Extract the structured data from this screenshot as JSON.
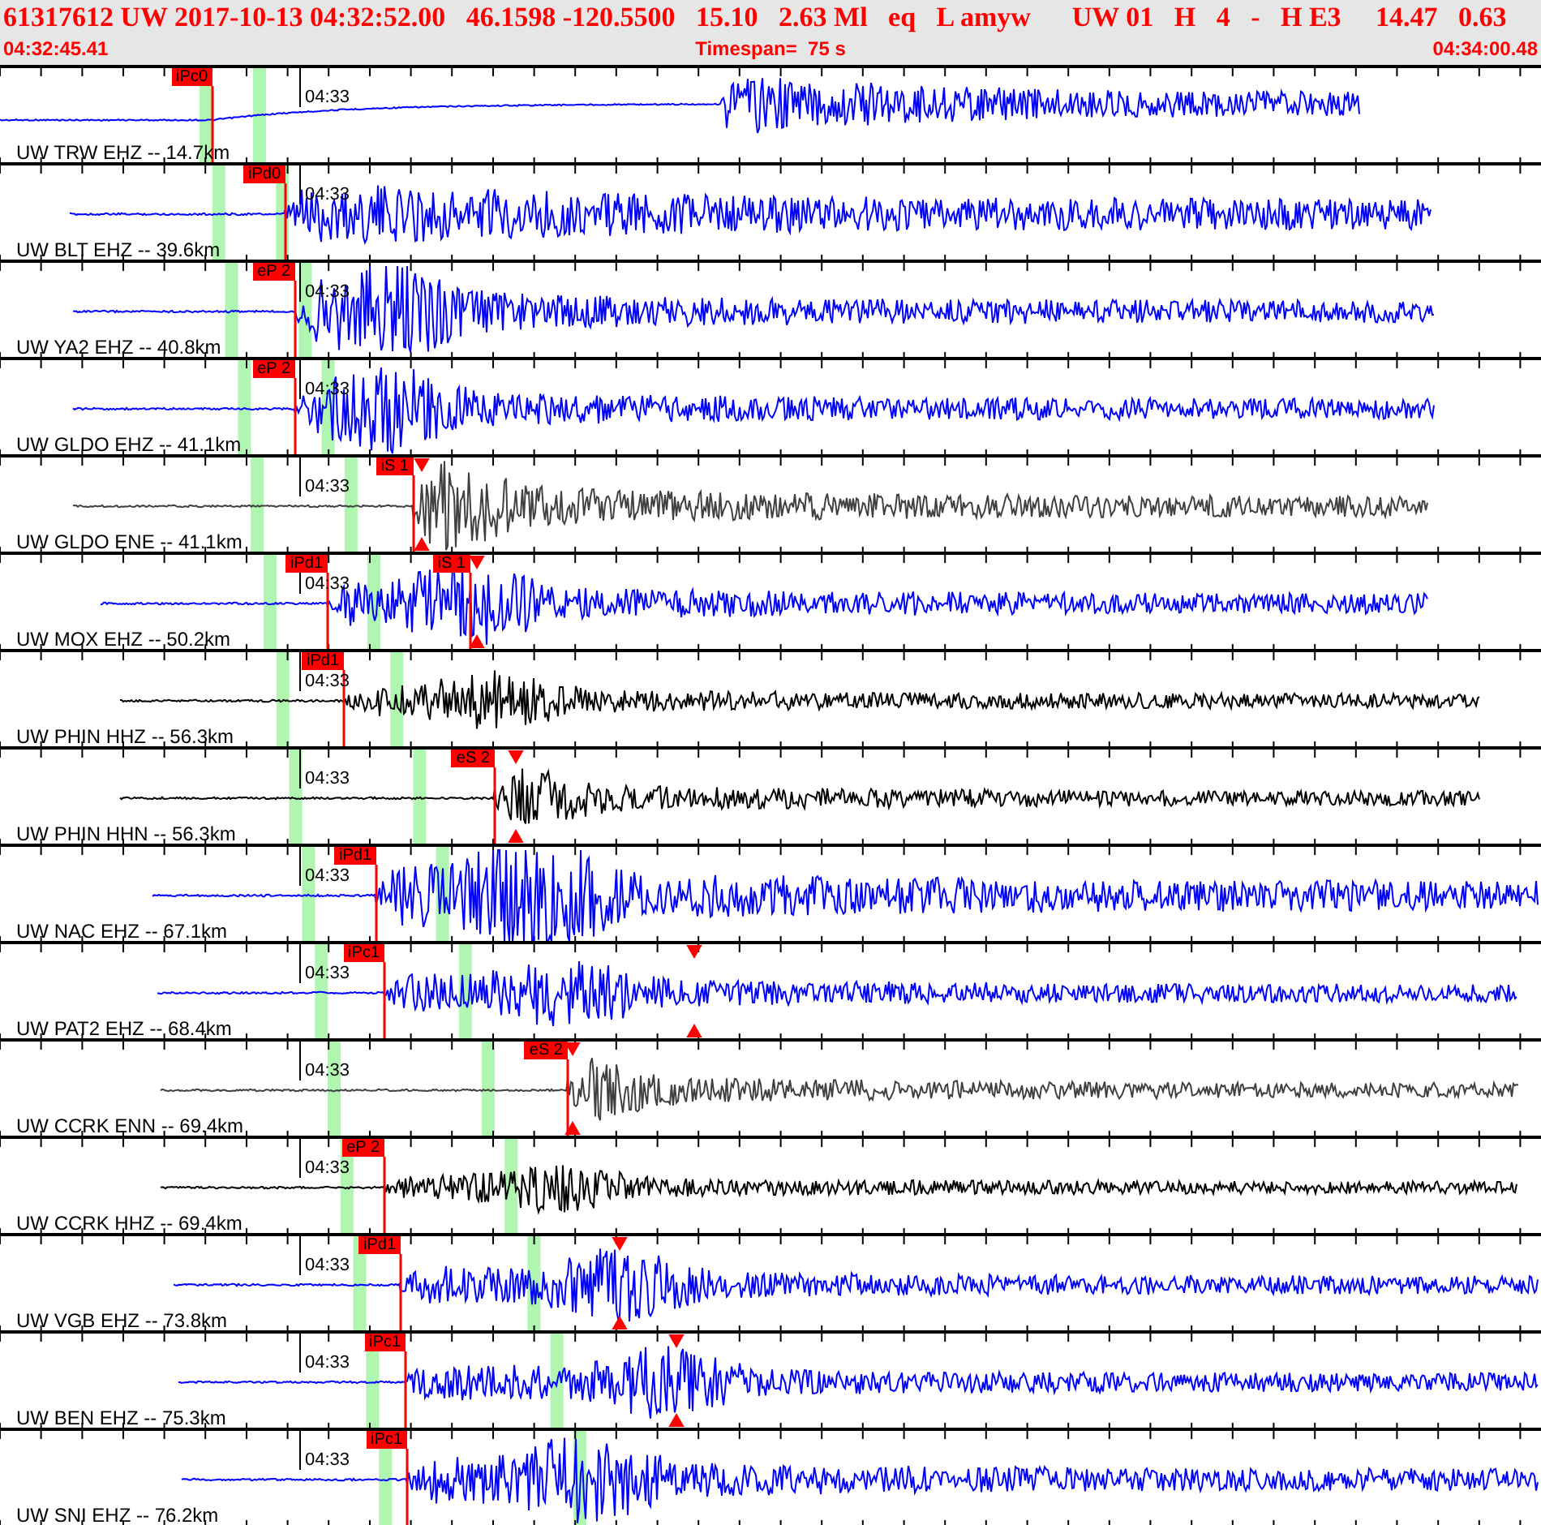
{
  "header": {
    "event_line": "61317612 UW 2017-10-13 04:32:52.00   46.1598 -120.5500   15.10   2.63 Ml   eq   L amyw      UW 01   H   4   -   H E3     14.47   0.63",
    "start_time": "04:32:45.41",
    "timespan": "Timespan=  75 s",
    "end_time": "04:34:00.48"
  },
  "traces": [
    {
      "label": "UW TRW EHZ -- 14.7km",
      "time_mark": "04:33",
      "color": "#0000ff",
      "picks": [
        {
          "kind": "flag",
          "label": "iPc0"
        }
      ]
    },
    {
      "label": "UW BLT EHZ -- 39.6km",
      "time_mark": "04:33",
      "color": "#0000ff",
      "picks": [
        {
          "kind": "flag",
          "label": "iPd0"
        }
      ]
    },
    {
      "label": "UW YA2 EHZ -- 40.8km",
      "time_mark": "04:33",
      "color": "#0000ff",
      "picks": [
        {
          "kind": "flag",
          "label": "eP 2"
        }
      ]
    },
    {
      "label": "UW GLDO EHZ -- 41.1km",
      "time_mark": "04:33",
      "color": "#0000ff",
      "picks": [
        {
          "kind": "flag",
          "label": "eP 2"
        }
      ]
    },
    {
      "label": "UW GLDO ENE -- 41.1km",
      "time_mark": "04:33",
      "color": "#404040",
      "picks": [
        {
          "kind": "flag",
          "label": "iS 1"
        },
        {
          "kind": "triangle"
        }
      ]
    },
    {
      "label": "UW MOX EHZ -- 50.2km",
      "time_mark": "04:33",
      "color": "#0000ff",
      "picks": [
        {
          "kind": "flag",
          "label": "iPd1"
        },
        {
          "kind": "flag",
          "label": "iS 1"
        },
        {
          "kind": "triangle"
        }
      ]
    },
    {
      "label": "UW PHIN HHZ -- 56.3km",
      "time_mark": "04:33",
      "color": "#000000",
      "picks": [
        {
          "kind": "flag",
          "label": "iPd1"
        }
      ]
    },
    {
      "label": "UW PHIN HHN -- 56.3km",
      "time_mark": "04:33",
      "color": "#000000",
      "picks": [
        {
          "kind": "flag",
          "label": "eS 2"
        },
        {
          "kind": "triangle"
        }
      ]
    },
    {
      "label": "UW NAC EHZ -- 67.1km",
      "time_mark": "04:33",
      "color": "#0000ff",
      "picks": [
        {
          "kind": "flag",
          "label": "iPd1"
        }
      ]
    },
    {
      "label": "UW PAT2 EHZ -- 68.4km",
      "time_mark": "04:33",
      "color": "#0000ff",
      "picks": [
        {
          "kind": "flag",
          "label": "iPc1"
        },
        {
          "kind": "triangle"
        }
      ]
    },
    {
      "label": "UW CCRK ENN -- 69.4km",
      "time_mark": "04:33",
      "color": "#404040",
      "picks": [
        {
          "kind": "flag",
          "label": "eS 2"
        },
        {
          "kind": "triangle"
        }
      ]
    },
    {
      "label": "UW CCRK HHZ -- 69.4km",
      "time_mark": "04:33",
      "color": "#000000",
      "picks": [
        {
          "kind": "flag",
          "label": "eP 2"
        }
      ]
    },
    {
      "label": "UW VGB EHZ -- 73.8km",
      "time_mark": "04:33",
      "color": "#0000ff",
      "picks": [
        {
          "kind": "flag",
          "label": "iPd1"
        },
        {
          "kind": "triangle"
        }
      ]
    },
    {
      "label": "UW BEN EHZ -- 75.3km",
      "time_mark": "04:33",
      "color": "#0000ff",
      "picks": [
        {
          "kind": "flag",
          "label": "iPc1"
        },
        {
          "kind": "triangle"
        }
      ]
    },
    {
      "label": "UW SNI EHZ -- 76.2km",
      "time_mark": "04:33",
      "color": "#0000ff",
      "picks": [
        {
          "kind": "flag",
          "label": "iPc1"
        }
      ]
    }
  ]
}
